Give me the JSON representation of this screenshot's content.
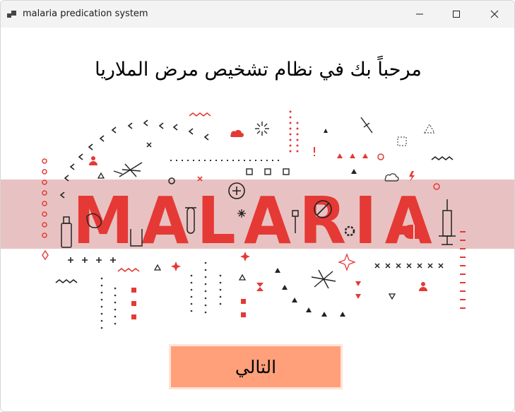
{
  "window": {
    "title": "malaria predication system",
    "icon": "app-window-icon"
  },
  "main": {
    "welcome_text": "مرحباً بك في نظام تشخيص مرض الملاريا",
    "banner_word": "MALARIA",
    "next_button_label": "التالي"
  },
  "colors": {
    "accent_red": "#e53935",
    "banner_band": "#e8c2c2",
    "button_fill": "#ffa07a",
    "dark_icon": "#333333"
  }
}
